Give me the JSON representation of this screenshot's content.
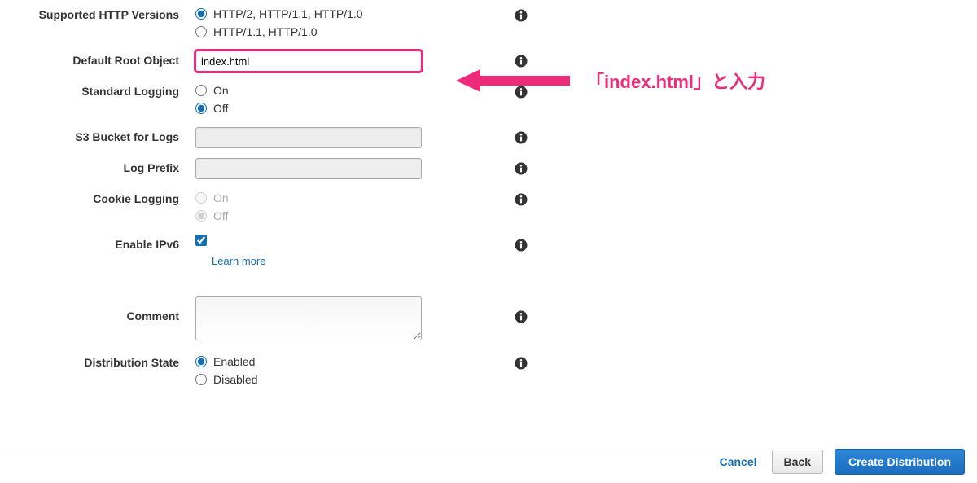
{
  "annotation": {
    "text": "「index.html」と入力"
  },
  "fields": {
    "http_versions": {
      "label": "Supported HTTP Versions",
      "option1": "HTTP/2, HTTP/1.1, HTTP/1.0",
      "option2": "HTTP/1.1, HTTP/1.0",
      "selected": "option1"
    },
    "default_root_object": {
      "label": "Default Root Object",
      "value": "index.html"
    },
    "standard_logging": {
      "label": "Standard Logging",
      "option1": "On",
      "option2": "Off",
      "selected": "option2"
    },
    "s3_bucket": {
      "label": "S3 Bucket for Logs",
      "value": ""
    },
    "log_prefix": {
      "label": "Log Prefix",
      "value": ""
    },
    "cookie_logging": {
      "label": "Cookie Logging",
      "option1": "On",
      "option2": "Off",
      "selected": "option2",
      "disabled": true
    },
    "enable_ipv6": {
      "label": "Enable IPv6",
      "checked": true,
      "learn_more": "Learn more"
    },
    "comment": {
      "label": "Comment",
      "value": ""
    },
    "distribution_state": {
      "label": "Distribution State",
      "option1": "Enabled",
      "option2": "Disabled",
      "selected": "option1"
    }
  },
  "footer": {
    "cancel": "Cancel",
    "back": "Back",
    "create": "Create Distribution"
  }
}
